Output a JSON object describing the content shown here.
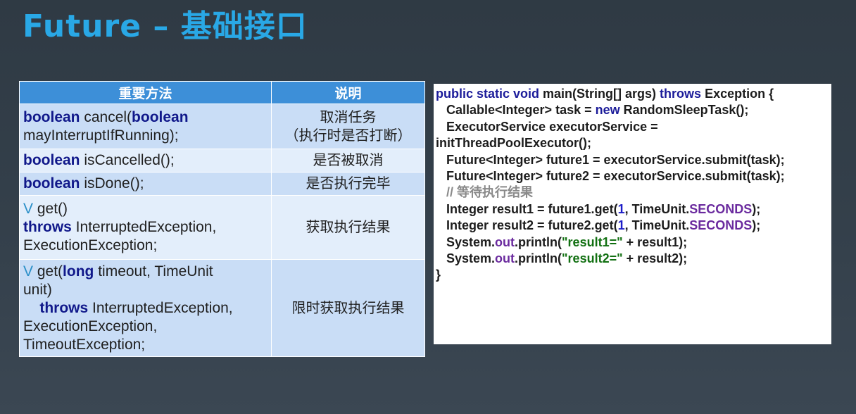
{
  "title": "Future – 基础接口",
  "table": {
    "headers": [
      "重要方法",
      "说明"
    ],
    "rows": [
      {
        "method": [
          [
            {
              "t": "boolean",
              "k": "kw"
            },
            {
              "t": " cancel("
            },
            {
              "t": "boolean",
              "k": "kw"
            }
          ],
          [
            {
              "t": "mayInterruptIfRunning);"
            }
          ]
        ],
        "desc": [
          "取消任务",
          "（执行时是否打断）"
        ]
      },
      {
        "method": [
          [
            {
              "t": "boolean",
              "k": "kw"
            },
            {
              "t": " isCancelled();"
            }
          ]
        ],
        "desc": [
          "是否被取消"
        ]
      },
      {
        "method": [
          [
            {
              "t": "boolean",
              "k": "kw"
            },
            {
              "t": " isDone();"
            }
          ]
        ],
        "desc": [
          "是否执行完毕"
        ]
      },
      {
        "method": [
          [
            {
              "t": "V",
              "k": "tv"
            },
            {
              "t": " get()"
            }
          ],
          [
            {
              "t": "throws",
              "k": "kw"
            },
            {
              "t": " InterruptedException,"
            }
          ],
          [
            {
              "t": "ExecutionException;"
            }
          ]
        ],
        "desc": [
          "获取执行结果"
        ]
      },
      {
        "method": [
          [
            {
              "t": "V",
              "k": "tv"
            },
            {
              "t": " get("
            },
            {
              "t": "long",
              "k": "kw"
            },
            {
              "t": " timeout, TimeUnit"
            }
          ],
          [
            {
              "t": "unit)"
            }
          ],
          [
            {
              "t": "    "
            },
            {
              "t": "throws",
              "k": "kw"
            },
            {
              "t": " InterruptedException,"
            }
          ],
          [
            {
              "t": "ExecutionException,"
            }
          ],
          [
            {
              "t": "TimeoutException;"
            }
          ]
        ],
        "desc": [
          "限时获取执行结果"
        ]
      }
    ]
  },
  "code": [
    [
      {
        "t": "public static void",
        "k": "ck"
      },
      {
        "t": " main(String[] args) "
      },
      {
        "t": "throws",
        "k": "ck"
      },
      {
        "t": " Exception {"
      }
    ],
    [
      {
        "t": "   Callable<Integer> task = "
      },
      {
        "t": "new",
        "k": "ck"
      },
      {
        "t": " RandomSleepTask();"
      }
    ],
    [
      {
        "t": "   ExecutorService executorService ="
      }
    ],
    [
      {
        "t": "initThreadPoolExecutor();"
      }
    ],
    [
      {
        "t": "   Future<Integer> future1 = executorService.submit(task);"
      }
    ],
    [
      {
        "t": "   Future<Integer> future2 = executorService.submit(task);"
      }
    ],
    [
      {
        "t": "   "
      },
      {
        "t": "// 等待执行结果",
        "k": "cmt"
      }
    ],
    [
      {
        "t": "   Integer result1 = future1.get("
      },
      {
        "t": "1",
        "k": "num"
      },
      {
        "t": ", TimeUnit."
      },
      {
        "t": "SECONDS",
        "k": "stat"
      },
      {
        "t": ");"
      }
    ],
    [
      {
        "t": "   Integer result2 = future2.get("
      },
      {
        "t": "1",
        "k": "num"
      },
      {
        "t": ", TimeUnit."
      },
      {
        "t": "SECONDS",
        "k": "stat"
      },
      {
        "t": ");"
      }
    ],
    [
      {
        "t": "   System."
      },
      {
        "t": "out",
        "k": "stat"
      },
      {
        "t": ".println("
      },
      {
        "t": "\"result1=\"",
        "k": "str"
      },
      {
        "t": " + result1);"
      }
    ],
    [
      {
        "t": "   System."
      },
      {
        "t": "out",
        "k": "stat"
      },
      {
        "t": ".println("
      },
      {
        "t": "\"result2=\"",
        "k": "str"
      },
      {
        "t": " + result2);"
      }
    ],
    [
      {
        "t": "}"
      }
    ]
  ]
}
